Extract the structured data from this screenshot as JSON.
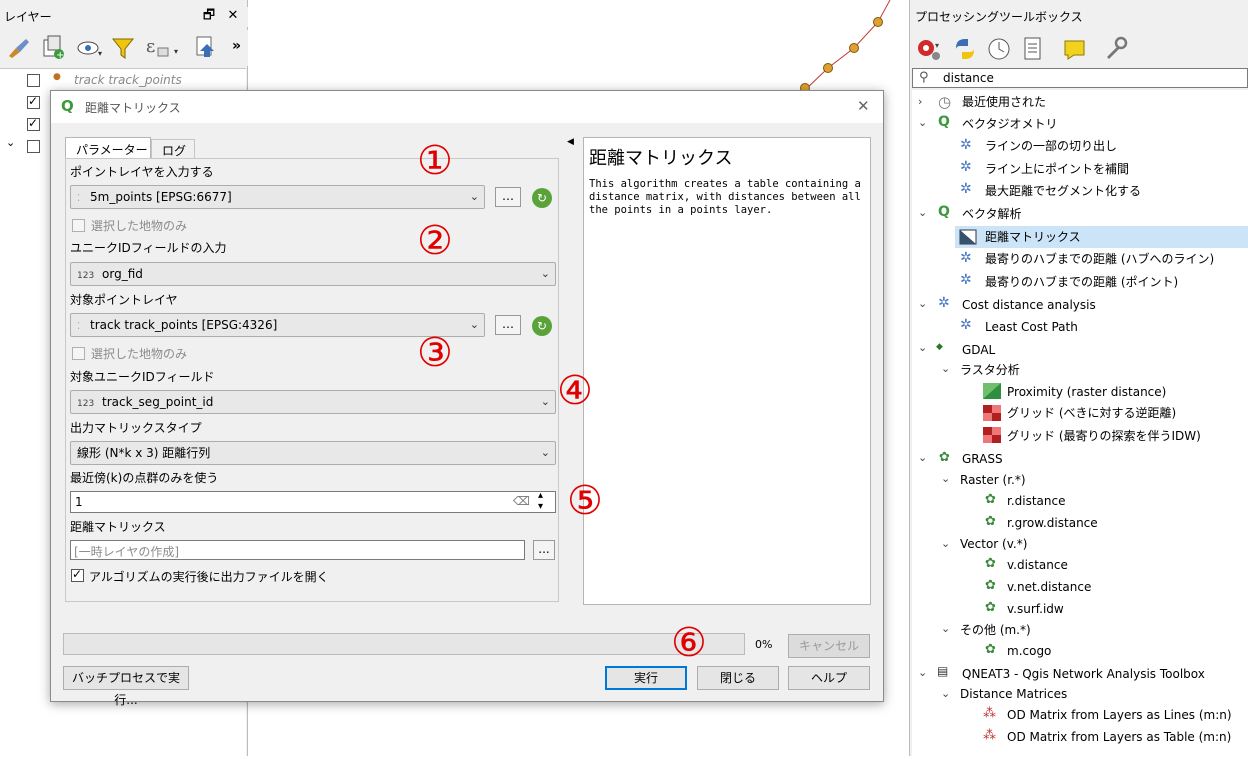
{
  "layers_panel": {
    "title": "レイヤー",
    "dock_float": "🗗",
    "dock_close": "✕",
    "more": "»",
    "layers": [
      {
        "label": "track track_points",
        "checked": false
      },
      {
        "label": "",
        "checked": true
      },
      {
        "label": "",
        "checked": true
      },
      {
        "label": "",
        "checked": false
      }
    ]
  },
  "toolbox": {
    "title": "プロセッシングツールボックス",
    "search_value": "distance",
    "tree": [
      {
        "label": "最近使用された",
        "level": 0,
        "chevron": "›"
      },
      {
        "label": "ベクタジオメトリ",
        "level": 0,
        "chevron": "⌄"
      },
      {
        "label": "ラインの一部の切り出し",
        "level": 1
      },
      {
        "label": "ライン上にポイントを補間",
        "level": 1
      },
      {
        "label": "最大距離でセグメント化する",
        "level": 1
      },
      {
        "label": "ベクタ解析",
        "level": 0,
        "chevron": "⌄"
      },
      {
        "label": "距離マトリックス",
        "level": 1,
        "selected": true
      },
      {
        "label": "最寄りのハブまでの距離 (ハブへのライン)",
        "level": 1
      },
      {
        "label": "最寄りのハブまでの距離 (ポイント)",
        "level": 1
      },
      {
        "label": "Cost distance analysis",
        "level": 0,
        "chevron": "⌄"
      },
      {
        "label": "Least Cost Path",
        "level": 1
      },
      {
        "label": "GDAL",
        "level": 0,
        "chevron": "⌄"
      },
      {
        "label": "ラスタ分析",
        "level": 1,
        "chevron": "⌄"
      },
      {
        "label": "Proximity (raster distance)",
        "level": 2
      },
      {
        "label": "グリッド (べきに対する逆距離)",
        "level": 2
      },
      {
        "label": "グリッド (最寄りの探索を伴うIDW)",
        "level": 2
      },
      {
        "label": "GRASS",
        "level": 0,
        "chevron": "⌄"
      },
      {
        "label": "Raster (r.*)",
        "level": 1,
        "chevron": "⌄"
      },
      {
        "label": "r.distance",
        "level": 2
      },
      {
        "label": "r.grow.distance",
        "level": 2
      },
      {
        "label": "Vector (v.*)",
        "level": 1,
        "chevron": "⌄"
      },
      {
        "label": "v.distance",
        "level": 2
      },
      {
        "label": "v.net.distance",
        "level": 2
      },
      {
        "label": "v.surf.idw",
        "level": 2
      },
      {
        "label": "その他 (m.*)",
        "level": 1,
        "chevron": "⌄"
      },
      {
        "label": "m.cogo",
        "level": 2
      },
      {
        "label": "QNEAT3 - Qgis Network Analysis Toolbox",
        "level": 0,
        "chevron": "⌄"
      },
      {
        "label": "Distance Matrices",
        "level": 1,
        "chevron": "⌄"
      },
      {
        "label": "OD Matrix from Layers as Lines (m:n)",
        "level": 2
      },
      {
        "label": "OD Matrix from Layers as Table (m:n)",
        "level": 2
      }
    ]
  },
  "dialog": {
    "title": "距離マトリックス",
    "close": "✕",
    "tabs": [
      "パラメーター",
      "ログ"
    ],
    "fields": {
      "input_points_label": "ポイントレイヤを入力する",
      "input_points_value": "5m_points [EPSG:6677]",
      "selected_only_1": "選択した地物のみ",
      "unique_id_label": "ユニークIDフィールドの入力",
      "unique_id_value": "org_fid",
      "target_points_label": "対象ポイントレイヤ",
      "target_points_value": "track track_points [EPSG:4326]",
      "selected_only_2": "選択した地物のみ",
      "target_id_label": "対象ユニークIDフィールド",
      "target_id_value": "track_seg_point_id",
      "matrix_type_label": "出力マトリックスタイプ",
      "matrix_type_value": "線形 (N*k x 3) 距離行列",
      "nearest_k_label": "最近傍(k)の点群のみを使う",
      "nearest_k_value": "1",
      "output_label": "距離マトリックス",
      "output_placeholder": "[一時レイヤの作成]",
      "open_after_label": "アルゴリズムの実行後に出力ファイルを開く",
      "num_badge": "123",
      "more_btn": "…",
      "ellipsis_btn": "..."
    },
    "help": {
      "title": "距離マトリックス",
      "text": "This algorithm creates a table containing a distance matrix, with distances between all the points in a points layer."
    },
    "progress": {
      "percent": "0%",
      "value": 0
    },
    "buttons": {
      "cancel": "キャンセル",
      "batch": "バッチプロセスで実行...",
      "run": "実行",
      "close": "閉じる",
      "help": "ヘルプ"
    },
    "annotations": [
      "①",
      "②",
      "③",
      "④",
      "⑤",
      "⑥"
    ]
  },
  "colors": {
    "annotation_red": "#e00000",
    "selection_blue": "#cce4f7",
    "track_line": "#c0392b",
    "track_point": "#e0a030"
  }
}
